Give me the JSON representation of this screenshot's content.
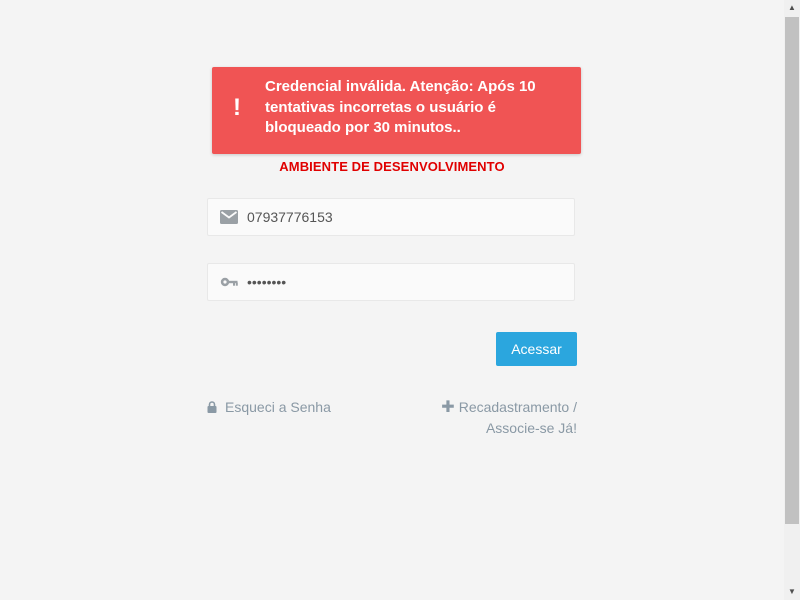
{
  "alert": {
    "icon": "exclamation-icon",
    "icon_glyph": "!",
    "message": "Credencial inválida. Atenção: Após 10 tentativas incorretas o usuário é bloqueado por 30 minutos..",
    "color": "#f05454"
  },
  "environment_label": "AMBIENTE DE DESENVOLVIMENTO",
  "login": {
    "user_icon": "envelope-icon",
    "user_value": "07937776153",
    "password_icon": "key-icon",
    "password_value": "••••••••",
    "submit_label": "Acessar",
    "submit_color": "#2ba6de"
  },
  "links": {
    "forgot_icon": "lock-icon",
    "forgot_label": "Esqueci a Senha",
    "register_icon": "plus-icon",
    "register_label_line1": "Recadastramento /",
    "register_label_line2": "Associe-se Já!"
  },
  "scrollbar": {
    "up_glyph": "▲",
    "down_glyph": "▼"
  }
}
